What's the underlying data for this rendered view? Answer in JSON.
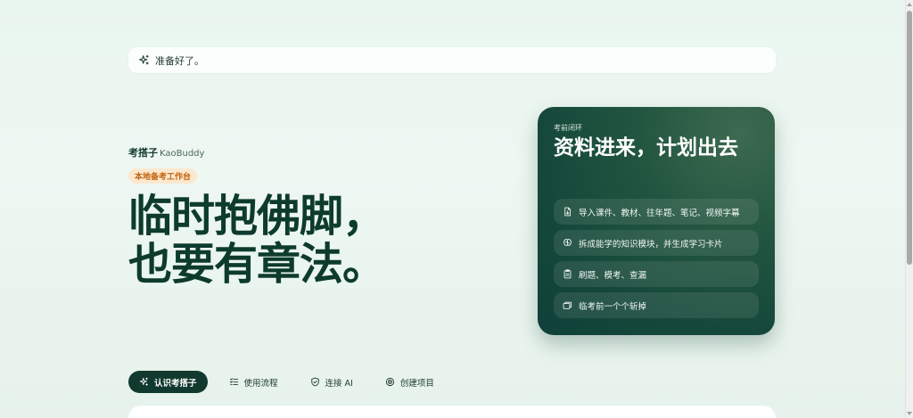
{
  "notice": {
    "icon": "sparkle-icon",
    "text": "准备好了。"
  },
  "brand": {
    "name_cn": "考搭子",
    "name_en": "KaoBuddy"
  },
  "badge": {
    "label": "本地备考工作台"
  },
  "headline": {
    "line1": "临时抱佛脚，",
    "line2": "也要有章法。"
  },
  "card": {
    "eyebrow": "考前闭环",
    "title": "资料进来，计划出去",
    "steps": [
      {
        "icon": "file-import-icon",
        "label": "导入课件、教材、往年题、笔记、视频字幕"
      },
      {
        "icon": "brain-icon",
        "label": "拆成能学的知识模块，并生成学习卡片"
      },
      {
        "icon": "clipboard-icon",
        "label": "刷题、模考、查漏"
      },
      {
        "icon": "cards-icon",
        "label": "临考前一个个斩掉"
      }
    ]
  },
  "tabs": [
    {
      "icon": "sparkle-icon",
      "label": "认识考搭子",
      "active": true
    },
    {
      "icon": "list-check-icon",
      "label": "使用流程",
      "active": false
    },
    {
      "icon": "shield-check-icon",
      "label": "连接 AI",
      "active": false
    },
    {
      "icon": "target-icon",
      "label": "创建项目",
      "active": false
    }
  ],
  "colors": {
    "background": "#eaf5ef",
    "brand_dark": "#0d3b2d",
    "badge_bg": "#fbe8cf",
    "badge_text": "#c2620c",
    "card_bg": "#15483a"
  }
}
